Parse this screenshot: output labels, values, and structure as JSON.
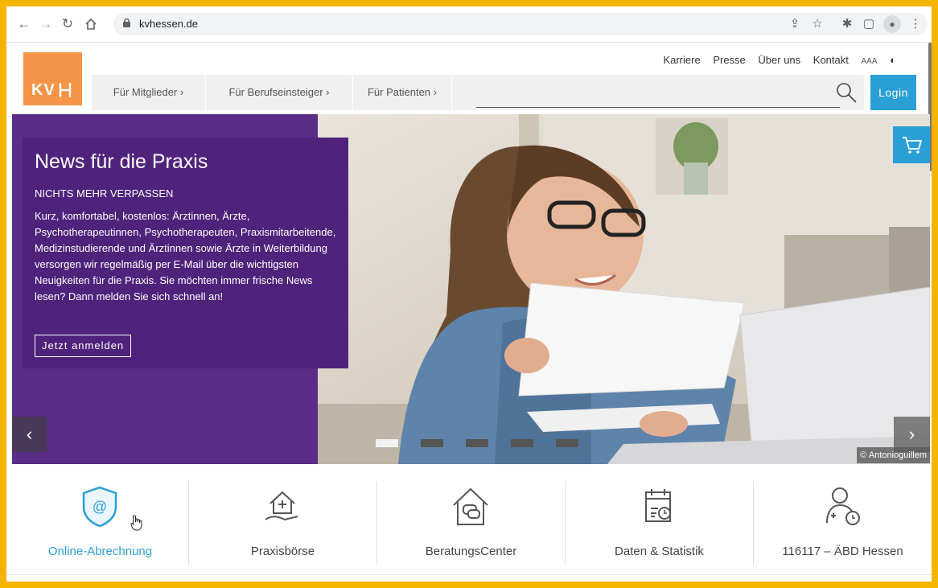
{
  "browser": {
    "url": "kvhessen.de",
    "nav_icons": [
      "back-icon",
      "forward-icon",
      "reload-icon",
      "home-icon"
    ],
    "toolbar_icons": [
      "share-icon",
      "star-icon",
      "extensions-icon",
      "sidepanel-icon",
      "profile-icon",
      "menu-icon"
    ]
  },
  "site": {
    "logo_text": "KV",
    "logo_color": "#f39446",
    "utility_nav": [
      "Karriere",
      "Presse",
      "Über uns",
      "Kontakt"
    ],
    "font_size_control": "AAA",
    "main_nav": [
      "Für Mitglieder",
      "Für Berufseinsteiger",
      "Für Patienten"
    ],
    "search_placeholder": "",
    "login_label": "Login",
    "accent_color": "#2a9fd6"
  },
  "hero": {
    "title": "News für die Praxis",
    "subtitle": "NICHTS MEHR VERPASSEN",
    "body": "Kurz, komfortabel, kostenlos: Ärztinnen, Ärzte, Psychotherapeutinnen, Psychotherapeuten, Praxismitarbeitende, Medizinstudierende und Ärztinnen sowie Ärzte in Weiterbildung versorgen wir regelmäßig per E-Mail über die wichtigsten Neuigkeiten für die Praxis. Sie möchten immer frische News lesen? Dann melden Sie sich schnell an!",
    "cta": "Jetzt anmelden",
    "credit": "© Antonioguillem",
    "slides_count": 5,
    "active_slide": 1,
    "panel_color": "#4f237c"
  },
  "quick_links": [
    {
      "label": "Online-Abrechnung",
      "icon": "shield-at-icon",
      "active": true
    },
    {
      "label": "Praxisbörse",
      "icon": "house-hand-icon",
      "active": false
    },
    {
      "label": "BeratungsCenter",
      "icon": "house-chat-icon",
      "active": false
    },
    {
      "label": "Daten & Statistik",
      "icon": "calendar-chart-icon",
      "active": false
    },
    {
      "label": "116117 – ÄBD Hessen",
      "icon": "doctor-clock-icon",
      "active": false
    }
  ]
}
